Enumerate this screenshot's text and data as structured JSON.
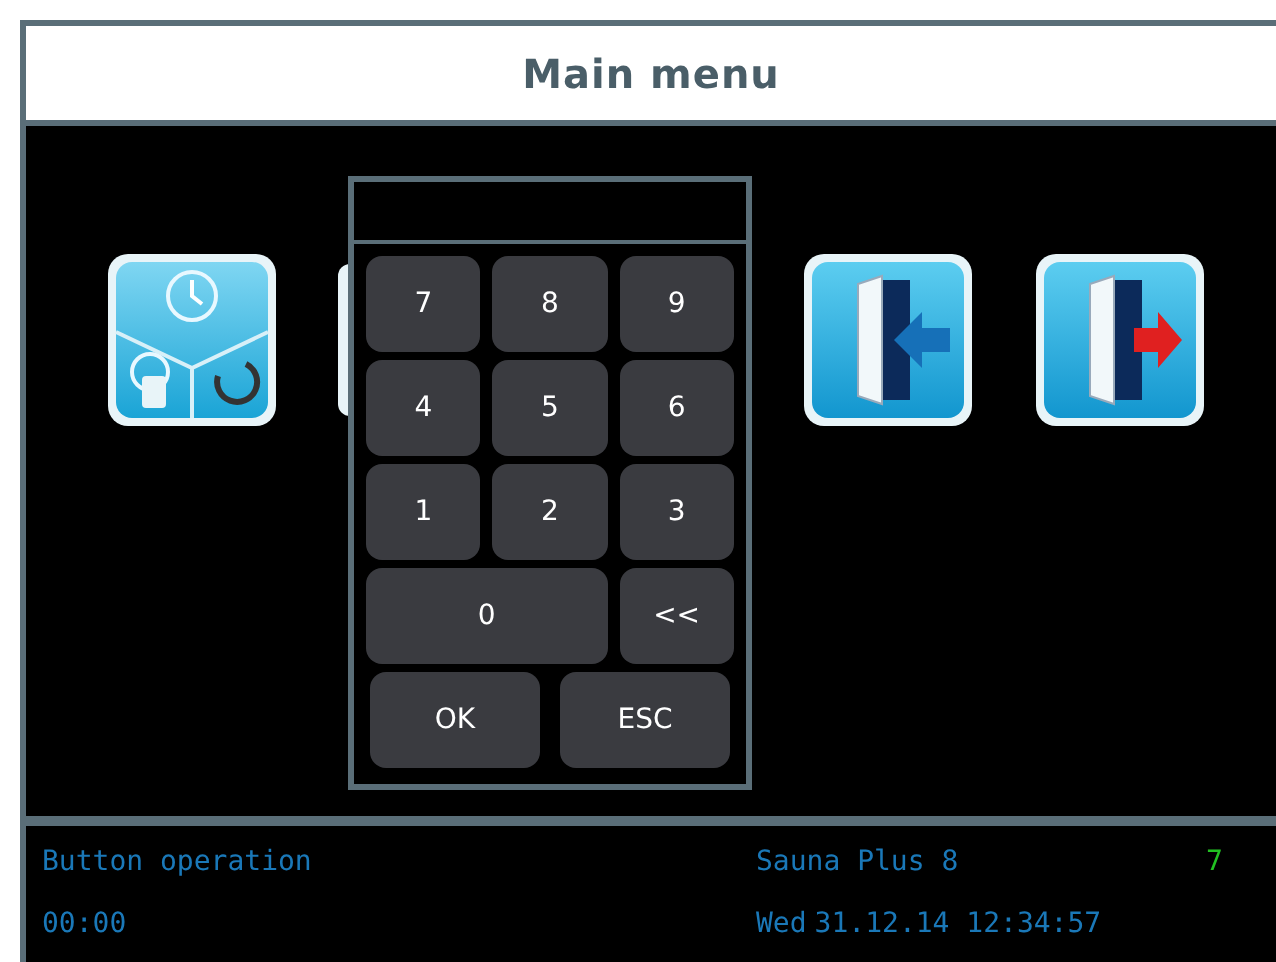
{
  "title": "Main menu",
  "menu_icons": [
    {
      "kind": "modes"
    },
    {
      "kind": "covered"
    },
    {
      "kind": "login"
    },
    {
      "kind": "logout"
    }
  ],
  "keypad": {
    "rows": [
      [
        {
          "label": "7",
          "kind": "key"
        },
        {
          "label": "8",
          "kind": "key"
        },
        {
          "label": "9",
          "kind": "key"
        }
      ],
      [
        {
          "label": "4",
          "kind": "key"
        },
        {
          "label": "5",
          "kind": "key"
        },
        {
          "label": "6",
          "kind": "key"
        }
      ],
      [
        {
          "label": "1",
          "kind": "key"
        },
        {
          "label": "2",
          "kind": "key"
        },
        {
          "label": "3",
          "kind": "key"
        }
      ],
      [
        {
          "label": "0",
          "kind": "wide"
        },
        {
          "label": "<<",
          "kind": "key"
        }
      ],
      [
        {
          "label": "OK",
          "kind": "half"
        },
        {
          "label": "ESC",
          "kind": "half"
        }
      ]
    ]
  },
  "status_bar": {
    "mode": "Button operation",
    "timer": "00:00",
    "device": "Sauna Plus 8",
    "indicator": "7",
    "day": "Wed",
    "datetime": "31.12.14 12:34:57"
  }
}
